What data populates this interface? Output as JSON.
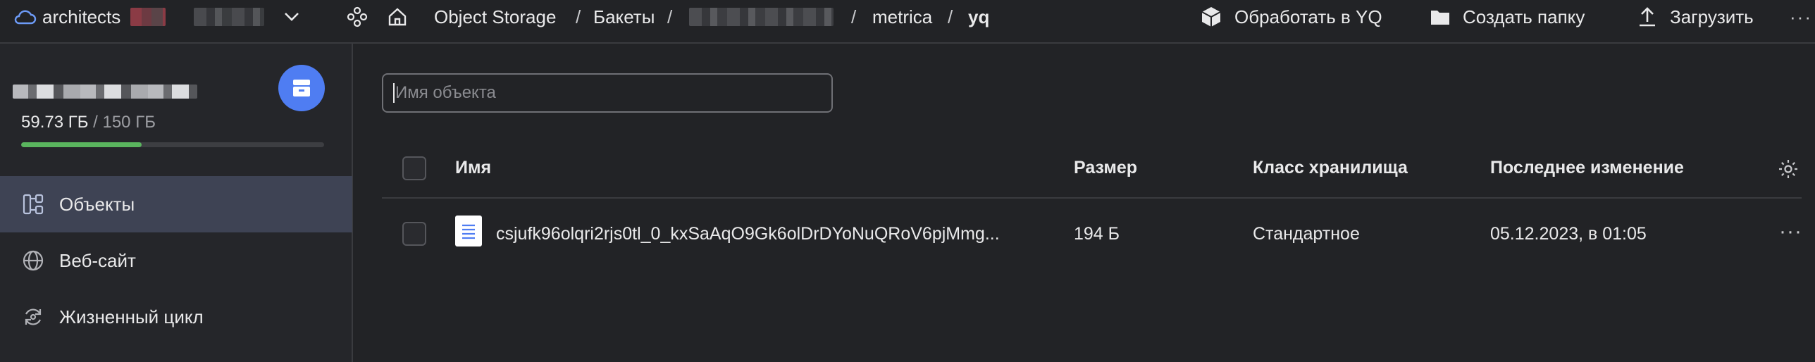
{
  "topbar": {
    "cloud_name": "architects",
    "breadcrumbs": [
      "Object Storage",
      "Бакеты",
      "metrica",
      "yq"
    ],
    "separator": "/",
    "actions": {
      "process_yq": "Обработать в YQ",
      "create_folder": "Создать папку",
      "upload": "Загрузить"
    }
  },
  "sidebar": {
    "storage_used": "59.73 ГБ",
    "storage_total": " / 150 ГБ",
    "storage_used_fraction": 0.398,
    "nav": [
      {
        "label": "Объекты",
        "icon": "objects-icon",
        "active": true
      },
      {
        "label": "Веб-сайт",
        "icon": "globe-icon",
        "active": false
      },
      {
        "label": "Жизненный цикл",
        "icon": "lifecycle-icon",
        "active": false
      }
    ]
  },
  "main": {
    "search_placeholder": "Имя объекта",
    "columns": {
      "name": "Имя",
      "size": "Размер",
      "storage_class": "Класс хранилища",
      "modified": "Последнее изменение"
    },
    "rows": [
      {
        "name": "csjufk96olqri2rjs0tl_0_kxSaAqO9Gk6olDrDYoNuQRoV6pjMmg...",
        "size": "194 Б",
        "storage_class": "Стандартное",
        "modified": "05.12.2023, в 01:05"
      }
    ]
  },
  "colors": {
    "background": "#222326",
    "accent": "#4f7df2",
    "progress": "#5ab55e",
    "active_nav": "#3e4354"
  }
}
